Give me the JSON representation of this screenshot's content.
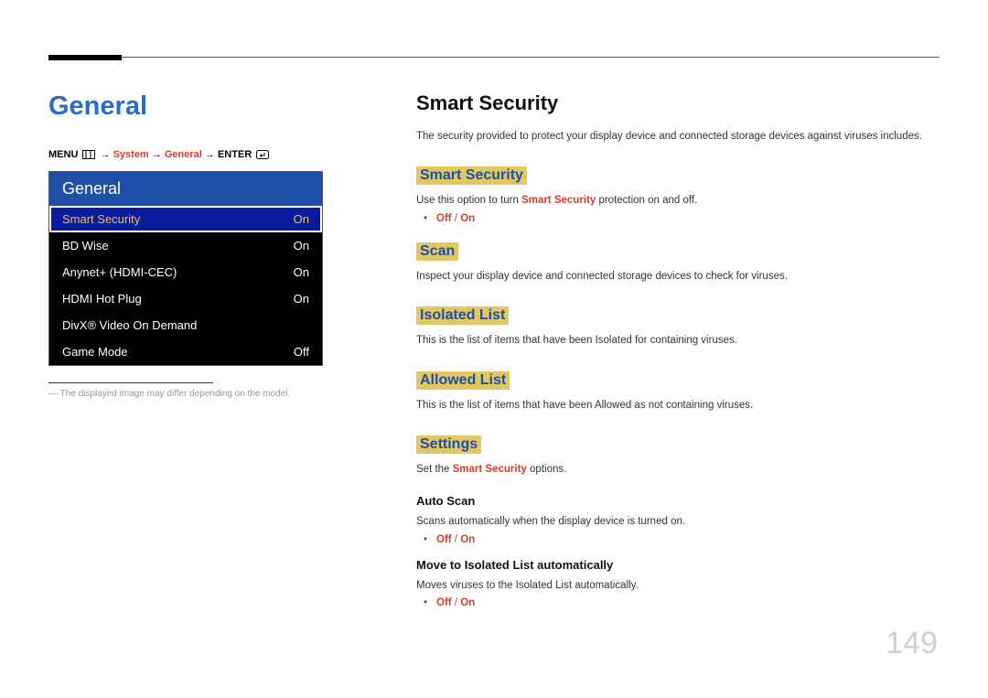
{
  "page_number": "149",
  "left": {
    "title": "General",
    "breadcrumb": {
      "menu": "MENU",
      "arrow": "→",
      "system": "System",
      "general": "General",
      "enter": "ENTER"
    },
    "menu": {
      "title": "General",
      "rows": [
        {
          "label": "Smart Security",
          "value": "On",
          "selected": true
        },
        {
          "label": "BD Wise",
          "value": "On",
          "selected": false
        },
        {
          "label": "Anynet+ (HDMI-CEC)",
          "value": "On",
          "selected": false
        },
        {
          "label": "HDMI Hot Plug",
          "value": "On",
          "selected": false
        },
        {
          "label": "DivX® Video On Demand",
          "value": "",
          "selected": false
        },
        {
          "label": "Game Mode",
          "value": "Off",
          "selected": false
        }
      ]
    },
    "footnote": "The displayed image may differ depending on the model."
  },
  "right": {
    "title": "Smart Security",
    "intro": "The security provided to protect your display device and connected storage devices against viruses includes.",
    "sections": {
      "smart_security": {
        "heading": "Smart Security",
        "desc_pre": "Use this option to turn ",
        "desc_highlight": "Smart Security",
        "desc_post": " protection on and off.",
        "option_off": "Off",
        "option_sep": " / ",
        "option_on": "On"
      },
      "scan": {
        "heading": "Scan",
        "desc": "Inspect your display device and connected storage devices to check for viruses."
      },
      "isolated": {
        "heading": "Isolated List",
        "desc": "This is the list of items that have been Isolated for containing viruses."
      },
      "allowed": {
        "heading": "Allowed List",
        "desc": "This is the list of items that have been Allowed as not containing viruses."
      },
      "settings": {
        "heading": "Settings",
        "desc_pre": "Set the ",
        "desc_highlight": "Smart Security",
        "desc_post": " options.",
        "auto_scan": {
          "heading": "Auto Scan",
          "desc": "Scans automatically when the display device is turned on.",
          "option_off": "Off",
          "option_sep": " / ",
          "option_on": "On"
        },
        "move_isolated": {
          "heading": "Move to Isolated List automatically",
          "desc": "Moves viruses to the Isolated List automatically.",
          "option_off": "Off",
          "option_sep": " / ",
          "option_on": "On"
        }
      }
    }
  }
}
